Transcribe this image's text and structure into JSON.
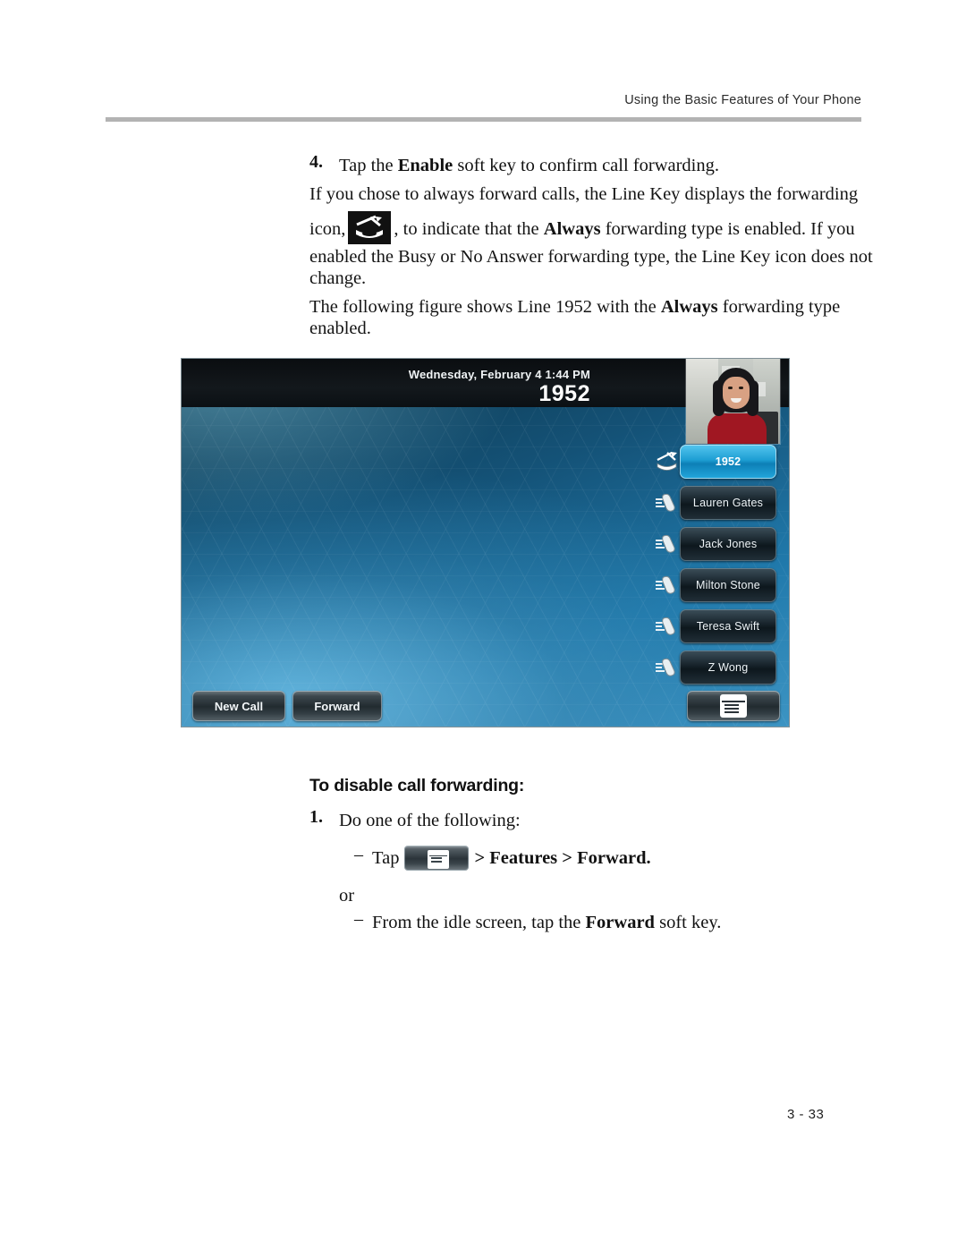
{
  "header": {
    "running_title": "Using the Basic Features of Your Phone"
  },
  "body": {
    "step4_number": "4.",
    "step4_text_1": "Tap the ",
    "step4_bold": "Enable",
    "step4_text_2": " soft key to confirm call forwarding.",
    "para1_line1": "If you chose to always forward calls, the Line Key displays the forwarding",
    "para1_pre_icon": "icon,",
    "para1_post_icon_1": ", to indicate that the ",
    "para1_post_icon_bold": "Always",
    "para1_post_icon_2": " forwarding type is enabled. If you",
    "para1_line3": "enabled the Busy or No Answer forwarding type, the Line Key icon does not",
    "para1_line4": "change.",
    "para2_pre": "The following figure shows Line 1952 with the ",
    "para2_bold": "Always",
    "para2_post": " forwarding type",
    "para2_line2": "enabled.",
    "forward_icon_name": "call-forward-icon"
  },
  "phone_screen": {
    "status_date": "Wednesday, February 4  1:44 PM",
    "line_number": "1952",
    "avatar_label": "contact-photo",
    "line_keys": [
      {
        "label": "1952",
        "icon": "call-forward-icon",
        "active": true
      },
      {
        "label": "Lauren Gates",
        "icon": "handset-icon",
        "active": false
      },
      {
        "label": "Jack Jones",
        "icon": "handset-icon",
        "active": false
      },
      {
        "label": "Milton Stone",
        "icon": "handset-icon",
        "active": false
      },
      {
        "label": "Teresa Swift",
        "icon": "handset-icon",
        "active": false
      },
      {
        "label": "Z Wong",
        "icon": "handset-icon",
        "active": false
      }
    ],
    "soft_keys": {
      "new_call": "New Call",
      "forward": "Forward",
      "home_icon": "home-menu-icon"
    },
    "colors": {
      "active_key": "#1d9ed3",
      "screen_blue": "#2079ab",
      "status_bar": "#0b1014"
    }
  },
  "disable_section": {
    "heading": "To disable call forwarding:",
    "step1_number": "1.",
    "step1_text": "Do one of the following:",
    "bullet1_marker": "–",
    "bullet1_pre": "Tap",
    "bullet1_icon": "home-menu-icon",
    "bullet1_post": "> Features > Forward.",
    "or_text": "or",
    "bullet2_marker": "–",
    "bullet2_pre": "From the idle screen, tap the ",
    "bullet2_bold": "Forward",
    "bullet2_post": " soft key."
  },
  "footer": {
    "page_number": "3 - 33"
  }
}
